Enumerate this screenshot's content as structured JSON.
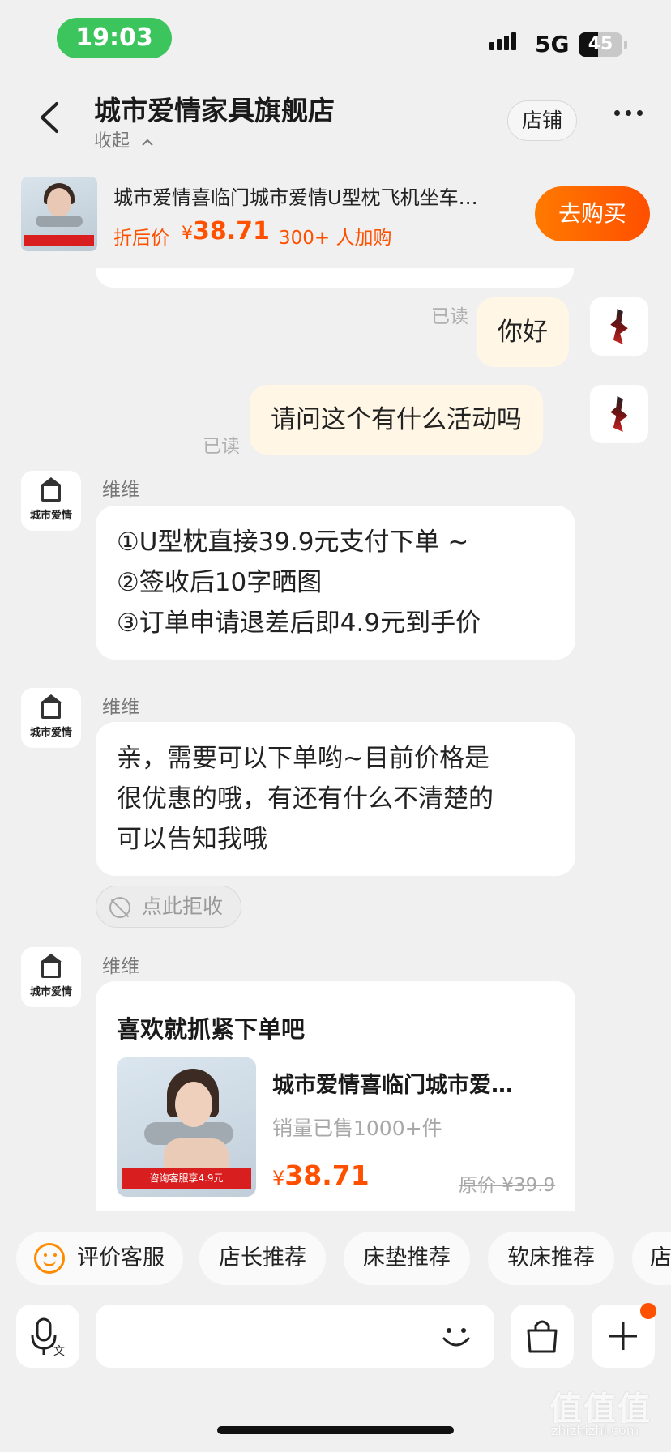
{
  "status_bar": {
    "time": "19:03",
    "network": "5G",
    "battery": "45",
    "battery_level": 0.45
  },
  "header": {
    "store_name": "城市爱情家具旗舰店",
    "collapse_label": "收起",
    "shop_button": "店铺"
  },
  "product_banner": {
    "name": "城市爱情喜临门城市爱情U型枕飞机坐车…",
    "price_label": "折后价",
    "currency": "¥",
    "price": "38.71",
    "sold_text": "300+ 人加购",
    "buy_button": "去购买"
  },
  "messages": {
    "outgoing": [
      {
        "text": "你好",
        "status": "已读"
      },
      {
        "text": "请问这个有什么活动吗",
        "status": "已读"
      }
    ],
    "agent_name": "维维",
    "agent_brand": "城市爱情",
    "agent_msg_1": [
      "①U型枕直接39.9元支付下单 ~",
      "②签收后10字晒图",
      "③订单申请退差后即4.9元到手价"
    ],
    "agent_msg_2": [
      "亲，需要可以下单哟~目前价格是",
      "很优惠的哦，有还有什么不清楚的",
      "可以告知我哦"
    ],
    "reject_label": "点此拒收",
    "product_card": {
      "title": "喜欢就抓紧下单吧",
      "name": "城市爱情喜临门城市爱…",
      "sales": "销量已售1000+件",
      "currency": "¥",
      "price": "38.71",
      "original_price": "原价 ¥39.9",
      "promo": "咨询客服享4.9元"
    }
  },
  "quick_replies": [
    "评价客服",
    "店长推荐",
    "床垫推荐",
    "软床推荐",
    "店"
  ],
  "input": {
    "placeholder": ""
  },
  "watermark": {
    "text": "值值值",
    "sub": "zhizhizhi.com"
  }
}
